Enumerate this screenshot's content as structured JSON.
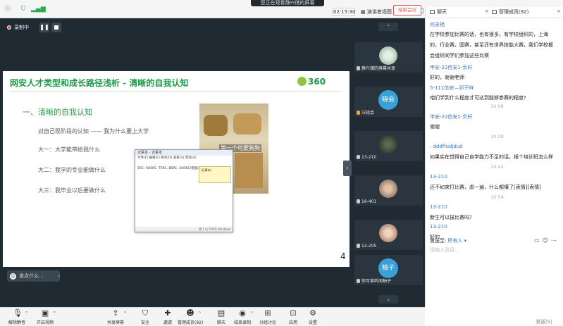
{
  "window": {
    "title": "您正在观看静兴储的屏幕",
    "timer": "02:15:30",
    "view_mode": "演讲者视图"
  },
  "recording": {
    "label": "录制中"
  },
  "slide": {
    "title": "网安人才类型和成长路径浅析 - 清晰的自我认知",
    "logo_text": "360",
    "heading": "一、清晰的自我认知",
    "lines": [
      "对自己现阶段的认知  ——  我为什么要上大学",
      "大一：大学能带给我什么",
      "大二：我学的专业能做什么",
      "大三：我毕业以后要做什么"
    ],
    "photo_caption": "第一个可爱狗狗",
    "dialog_title": "记事本 - 记事本",
    "dialog_menu": "文件(F) 编辑(E) 格式(O) 查看(V) 帮助(H)",
    "dialog_body": "SRC: AUSRC, TSRC, BSRC, XNSRC(拓展)",
    "dialog_footer": "第 1 行  100%  Windows",
    "popup_text": "[记事本]",
    "page_number": "4"
  },
  "chat_input": {
    "placeholder": "说点什么..."
  },
  "participants": [
    {
      "name": "静兴储的屏幕共享",
      "avatar": "photo"
    },
    {
      "name": "汪晓会",
      "avatar_text": "晓会"
    },
    {
      "name": "13-210",
      "avatar": "photo"
    },
    {
      "name": "16-401",
      "avatar": "photo"
    },
    {
      "name": "12-205",
      "avatar": "photo"
    },
    {
      "name": "你可曾听闻柚子",
      "avatar_text": "柚子"
    }
  ],
  "panel": {
    "chat_tab": "聊天",
    "members_tab": "管理成员(92)",
    "messages": [
      {
        "kind": "name",
        "text": "何永艳"
      },
      {
        "kind": "text",
        "text": "在学校参加比赛的话，也有很多，有学校组织的，上海"
      },
      {
        "kind": "text",
        "text": "的，行业赛，国赛，甚至还有世界技能大赛，我们学校都"
      },
      {
        "kind": "text",
        "text": "会组织同学们参加这些比赛"
      },
      {
        "kind": "name",
        "text": "申安-22信安1-负轩"
      },
      {
        "kind": "text",
        "text": "好的，谢谢老师"
      },
      {
        "kind": "name",
        "text": "5-111信安—邓子祥"
      },
      {
        "kind": "text",
        "text": "咱们学到什么程度才可达到能够参赛的程度?"
      },
      {
        "kind": "time",
        "text": "10:08"
      },
      {
        "kind": "name",
        "text": "申安-22信安1-负轩"
      },
      {
        "kind": "text",
        "text": "谢谢"
      },
      {
        "kind": "time",
        "text": "10:28"
      },
      {
        "kind": "name",
        "text": ". dddffudjdud"
      },
      {
        "kind": "text",
        "text": "如果实在觉得自己自学能力不足的话，报个培训班怎么样"
      },
      {
        "kind": "time",
        "text": "10:42"
      },
      {
        "kind": "name",
        "text": "13-210"
      },
      {
        "kind": "text",
        "text": "还不如来打比赛，虐一遍，什么都懂了[表情][表情]"
      },
      {
        "kind": "time",
        "text": "10:54"
      },
      {
        "kind": "name",
        "text": "13-210"
      },
      {
        "kind": "text",
        "text": "新生可以报比赛吗?"
      },
      {
        "kind": "name",
        "text": "13-210"
      },
      {
        "kind": "text",
        "text": "好的"
      }
    ],
    "send_to_label": "发送至:",
    "send_to_value": "所有人",
    "input_placeholder": "请输入消息...",
    "send_button": "发送(S)"
  },
  "toolbar": {
    "items": [
      {
        "label": "解除静音",
        "icon": "mic-icon"
      },
      {
        "label": "开启视频",
        "icon": "camera-off-icon"
      },
      {
        "label": "共享屏幕",
        "icon": "share-screen-icon"
      },
      {
        "label": "安全",
        "icon": "shield-icon"
      },
      {
        "label": "邀请",
        "icon": "invite-icon"
      },
      {
        "label": "管理成员(92)",
        "icon": "members-icon"
      },
      {
        "label": "聊天",
        "icon": "chat-icon"
      },
      {
        "label": "结束录制",
        "icon": "record-icon"
      },
      {
        "label": "分组讨论",
        "icon": "breakout-icon"
      },
      {
        "label": "应用",
        "icon": "apps-icon"
      },
      {
        "label": "设置",
        "icon": "gear-icon"
      }
    ],
    "end_meeting": "结束会议"
  },
  "colors": {
    "stage_bg": "#1f2a33",
    "slide_accent": "#1d9a48",
    "chat_name": "#3b78c4",
    "end_button": "#e05050"
  }
}
